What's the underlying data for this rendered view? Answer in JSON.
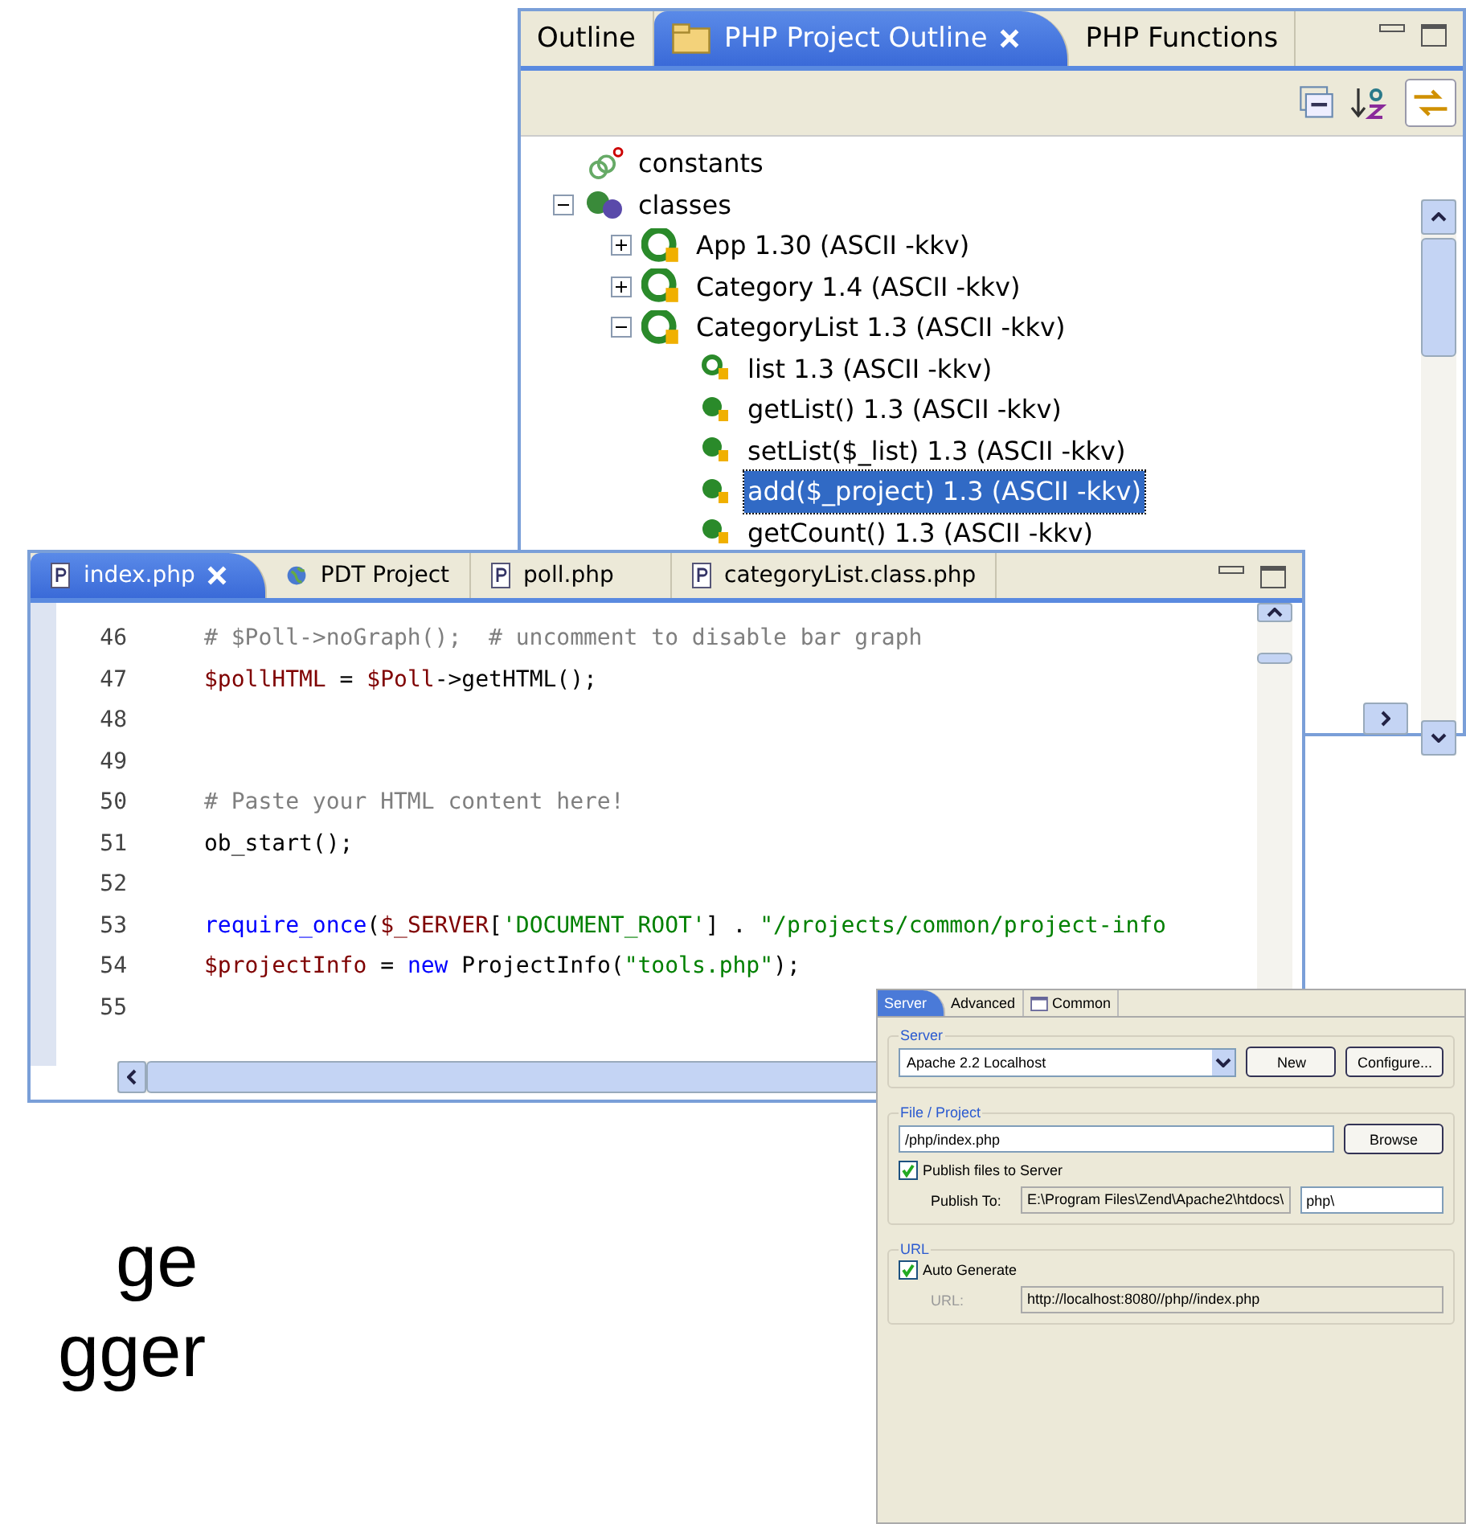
{
  "slide_text": [
    "ge",
    "gger"
  ],
  "outline": {
    "tabs": [
      {
        "label": "Outline",
        "selected": false,
        "closable": false,
        "icon": false
      },
      {
        "label": "PHP Project Outline",
        "selected": true,
        "closable": true,
        "icon": true
      },
      {
        "label": "PHP Functions",
        "selected": false,
        "closable": false,
        "icon": false
      }
    ],
    "tree": [
      {
        "label": "constants",
        "kind": "constants",
        "selected": false
      },
      {
        "label": "classes",
        "kind": "classes",
        "expanded": true,
        "selected": false,
        "children": [
          {
            "label": "App  1.30  (ASCII -kkv)",
            "kind": "class",
            "expanded": false,
            "selected": false
          },
          {
            "label": "Category  1.4  (ASCII -kkv)",
            "kind": "class",
            "expanded": false,
            "selected": false
          },
          {
            "label": "CategoryList  1.3  (ASCII -kkv)",
            "kind": "class",
            "expanded": true,
            "selected": false,
            "children": [
              {
                "label": "list  1.3  (ASCII -kkv)",
                "kind": "field",
                "selected": false
              },
              {
                "label": "getList()  1.3  (ASCII -kkv)",
                "kind": "method",
                "selected": false
              },
              {
                "label": "setList($_list)  1.3  (ASCII -kkv)",
                "kind": "method",
                "selected": false
              },
              {
                "label": "add($_project)  1.3  (ASCII -kkv)",
                "kind": "method",
                "selected": true
              },
              {
                "label": "getCount()  1.3  (ASCII -kkv)",
                "kind": "method",
                "selected": false
              }
            ]
          }
        ]
      }
    ]
  },
  "editor": {
    "tabs": [
      {
        "label": "index.php",
        "selected": true,
        "closable": true,
        "kind": "file"
      },
      {
        "label": "PDT Project",
        "selected": false,
        "closable": false,
        "kind": "globe"
      },
      {
        "label": "poll.php",
        "selected": false,
        "closable": false,
        "kind": "file"
      },
      {
        "label": "categoryList.class.php",
        "selected": false,
        "closable": false,
        "kind": "file"
      }
    ],
    "lines": [
      {
        "number": "46",
        "tokens": [
          {
            "kind": "comment",
            "text": "# $Poll->noGraph();  # uncomment to disable bar graph"
          }
        ]
      },
      {
        "number": "47",
        "tokens": [
          {
            "kind": "var",
            "text": "$pollHTML"
          },
          {
            "kind": "plain",
            "text": " = "
          },
          {
            "kind": "var",
            "text": "$Poll"
          },
          {
            "kind": "plain",
            "text": "->getHTML();"
          }
        ]
      },
      {
        "number": "48"
      },
      {
        "number": "49"
      },
      {
        "number": "50",
        "tokens": [
          {
            "kind": "comment",
            "text": "# Paste your HTML content here!"
          }
        ]
      },
      {
        "number": "51",
        "tokens": [
          {
            "kind": "plain",
            "text": "ob_start();"
          }
        ]
      },
      {
        "number": "52"
      },
      {
        "number": "53",
        "tokens": [
          {
            "kind": "keyword",
            "text": "require_once"
          },
          {
            "kind": "plain",
            "text": "("
          },
          {
            "kind": "var",
            "text": "$_SERVER"
          },
          {
            "kind": "plain",
            "text": "["
          },
          {
            "kind": "string",
            "text": "'DOCUMENT_ROOT'"
          },
          {
            "kind": "plain",
            "text": "] . "
          },
          {
            "kind": "string",
            "text": "\"/projects/common/project-info"
          }
        ]
      },
      {
        "number": "54",
        "tokens": [
          {
            "kind": "var",
            "text": "$projectInfo"
          },
          {
            "kind": "plain",
            "text": " = "
          },
          {
            "kind": "keyword",
            "text": "new"
          },
          {
            "kind": "plain",
            "text": " ProjectInfo("
          },
          {
            "kind": "string",
            "text": "\"tools.php\""
          },
          {
            "kind": "plain",
            "text": ");"
          }
        ]
      },
      {
        "number": "55"
      }
    ]
  },
  "dialog": {
    "tabs": [
      {
        "label": "Server",
        "selected": true
      },
      {
        "label": "Advanced",
        "selected": false
      },
      {
        "label": "Common",
        "selected": false
      }
    ],
    "server": {
      "legend": "Server",
      "value": "Apache 2.2 Localhost",
      "buttons": [
        "New",
        "Configure..."
      ]
    },
    "file": {
      "legend": "File / Project",
      "value": "/php/index.php",
      "button": "Browse",
      "publish": {
        "label": "Publish files to Server",
        "checked": true
      },
      "publish_to_label": "Publish To:",
      "publish_base": "E:\\Program Files\\Zend\\Apache2\\htdocs\\",
      "publish_dir": "php\\"
    },
    "url": {
      "legend": "URL",
      "auto": {
        "label": "Auto Generate",
        "checked": true
      },
      "url_label": "URL:",
      "url_value": "http://localhost:8080//php//index.php"
    }
  }
}
